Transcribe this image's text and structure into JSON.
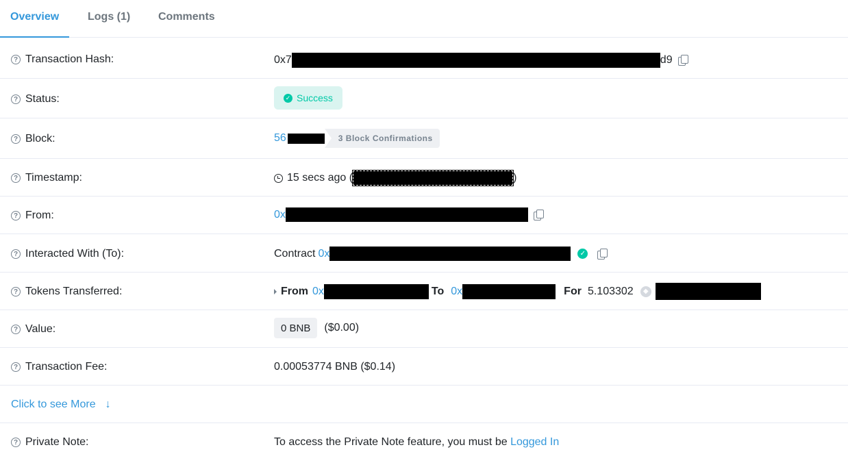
{
  "tabs": {
    "overview": "Overview",
    "logs": "Logs (1)",
    "comments": "Comments"
  },
  "rows": {
    "tx_hash": {
      "label": "Transaction Hash:",
      "prefix": "0x7",
      "suffix": "d9"
    },
    "status": {
      "label": "Status:",
      "value": "Success"
    },
    "block": {
      "label": "Block:",
      "prefix": "56",
      "confirmations": "3 Block Confirmations"
    },
    "timestamp": {
      "label": "Timestamp:",
      "ago": "15 secs ago (",
      "close": ")"
    },
    "from": {
      "label": "From:",
      "prefix": "0x"
    },
    "interacted": {
      "label": "Interacted With (To):",
      "contract": "Contract",
      "prefix": "0x"
    },
    "tokens": {
      "label": "Tokens Transferred:",
      "from_label": "From",
      "from_prefix": "0x",
      "to_label": "To",
      "to_prefix": "0x",
      "for_label": "For",
      "amount": "5.103302"
    },
    "value": {
      "label": "Value:",
      "amount": "0 BNB",
      "usd": "($0.00)"
    },
    "fee": {
      "label": "Transaction Fee:",
      "value": "0.00053774 BNB ($0.14)"
    },
    "more": {
      "label": "Click to see More",
      "arrow": "↓"
    },
    "note": {
      "label": "Private Note:",
      "text": "To access the Private Note feature, you must be ",
      "link": "Logged In"
    }
  },
  "colors": {
    "accent": "#3498db",
    "success": "#00c9a7",
    "border": "#e7eaf3"
  }
}
